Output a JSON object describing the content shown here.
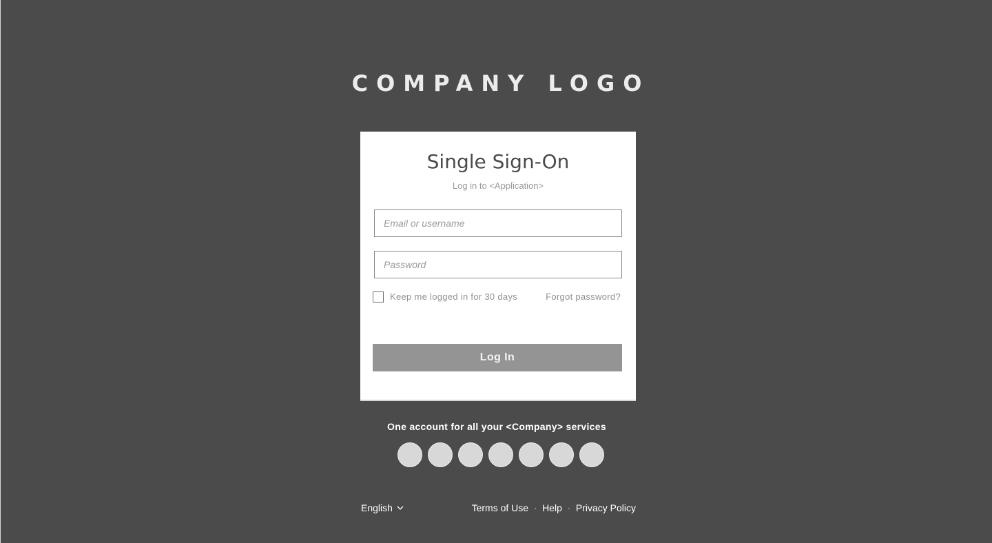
{
  "logo": {
    "text": "COMPANY LOGO"
  },
  "card": {
    "title": "Single Sign-On",
    "subtitle": "Log in to <Application>",
    "email_placeholder": "Email or username",
    "password_placeholder": "Password",
    "remember_label": "Keep me logged in for 30 days",
    "forgot_label": "Forgot password?",
    "login_label": "Log In"
  },
  "services": {
    "tagline": "One account for all your <Company> services",
    "count": 7
  },
  "footer": {
    "language": "English",
    "links": {
      "terms": "Terms of Use",
      "help": "Help",
      "privacy": "Privacy Policy"
    },
    "separator": "·"
  },
  "colors": {
    "background": "#4b4b4b",
    "card": "#ffffff",
    "button": "#949494",
    "service_circle": "#d8d8d8"
  }
}
